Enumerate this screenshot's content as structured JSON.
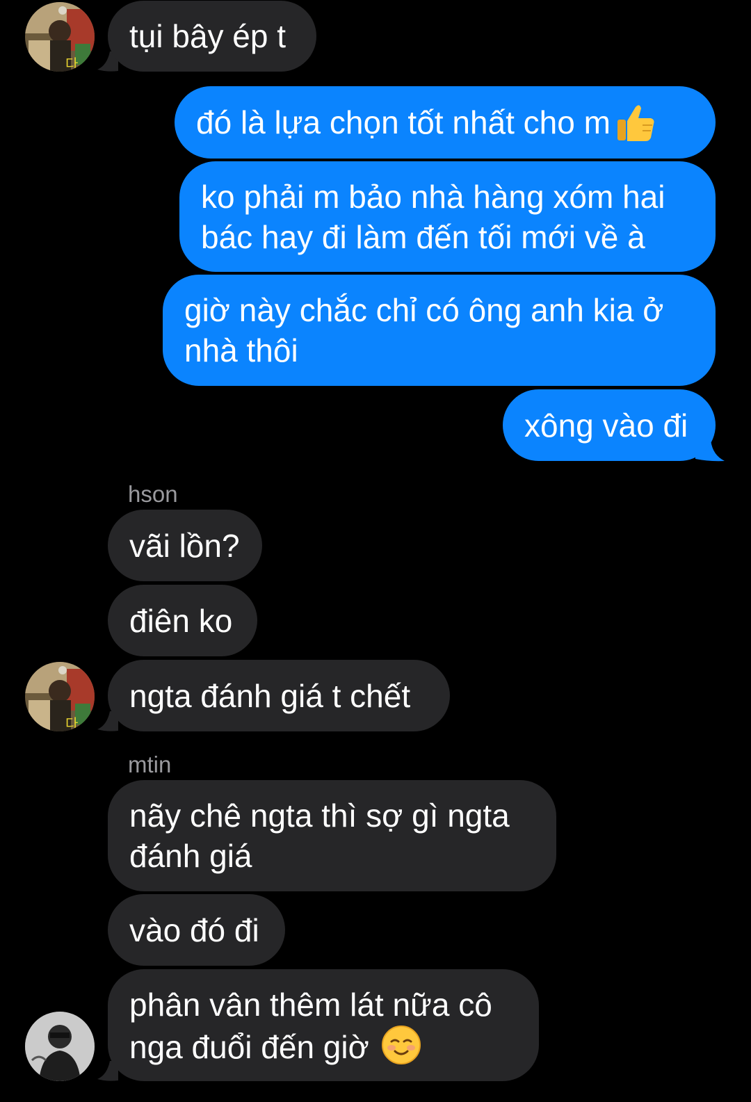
{
  "colors": {
    "background": "#000000",
    "incoming_bubble": "#262628",
    "outgoing_bubble": "#0b84fe",
    "sender_label": "#9a9a9e"
  },
  "messages": [
    {
      "id": "m1",
      "direction": "incoming",
      "avatar": "avatar-a",
      "text": "tụi bây ép t"
    },
    {
      "id": "m2",
      "direction": "outgoing",
      "text": "đó là lựa chọn tốt nhất cho m",
      "emoji": "thumbs-up-emoji"
    },
    {
      "id": "m3",
      "direction": "outgoing",
      "lines": [
        "ko phải m bảo nhà hàng xóm hai",
        "bác hay đi làm đến tối mới về à"
      ]
    },
    {
      "id": "m4",
      "direction": "outgoing",
      "lines": [
        "giờ này chắc chỉ có ông anh kia ở",
        "nhà thôi"
      ]
    },
    {
      "id": "m5",
      "direction": "outgoing",
      "text": "xông vào đi"
    },
    {
      "id": "s1",
      "type": "sender",
      "text": "hson"
    },
    {
      "id": "m6",
      "direction": "incoming",
      "text": "vãi lồn?"
    },
    {
      "id": "m7",
      "direction": "incoming",
      "text": "điên ko"
    },
    {
      "id": "m8",
      "direction": "incoming",
      "avatar": "avatar-a",
      "text": "ngta đánh giá t chết"
    },
    {
      "id": "s2",
      "type": "sender",
      "text": "mtin"
    },
    {
      "id": "m9",
      "direction": "incoming",
      "lines": [
        "nãy chê ngta thì sợ gì ngta",
        "đánh giá"
      ]
    },
    {
      "id": "m10",
      "direction": "incoming",
      "text": "vào đó đi"
    },
    {
      "id": "m11",
      "direction": "incoming",
      "avatar": "avatar-b",
      "lines": [
        "phân vân thêm lát nữa cô",
        "nga đuổi đến giờ"
      ],
      "emoji": "smiling-face-emoji"
    }
  ]
}
